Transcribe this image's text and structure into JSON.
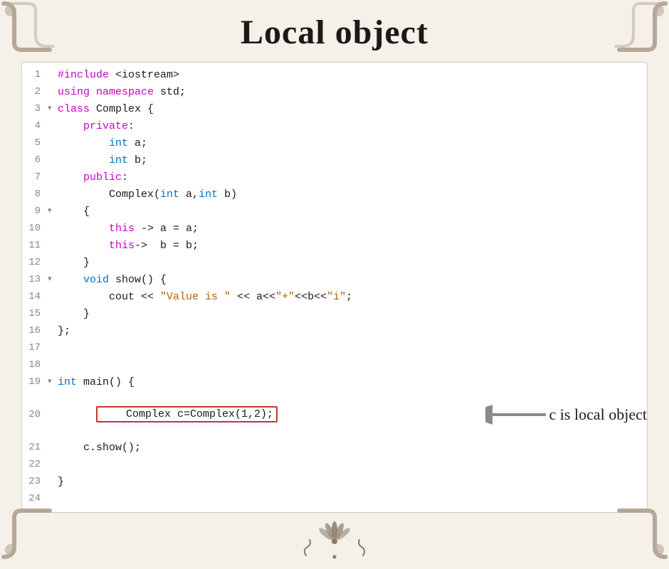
{
  "title": "Local object",
  "lines": [
    {
      "num": "1",
      "arrow": "",
      "code": "<span class='kw-purple'>#include</span> <span class='kw-dark'>&lt;iostream&gt;</span>"
    },
    {
      "num": "2",
      "arrow": "",
      "code": "<span class='kw-purple'>using namespace</span> <span class='kw-dark'>std;</span>"
    },
    {
      "num": "3",
      "arrow": "▾",
      "code": "<span class='kw-purple'>class</span> <span class='kw-dark'>Complex {</span>"
    },
    {
      "num": "4",
      "arrow": "",
      "code": "    <span class='kw-purple'>private</span><span class='kw-dark'>:</span>"
    },
    {
      "num": "5",
      "arrow": "",
      "code": "        <span class='kw-blue'>int</span> <span class='kw-dark'>a;</span>"
    },
    {
      "num": "6",
      "arrow": "",
      "code": "        <span class='kw-blue'>int</span> <span class='kw-dark'>b;</span>"
    },
    {
      "num": "7",
      "arrow": "",
      "code": "    <span class='kw-purple'>public</span><span class='kw-dark'>:</span>"
    },
    {
      "num": "8",
      "arrow": "",
      "code": "        <span class='kw-dark'>Complex(</span><span class='kw-blue'>int</span><span class='kw-dark'> a,</span><span class='kw-blue'>int</span><span class='kw-dark'> b)</span>"
    },
    {
      "num": "9",
      "arrow": "▾",
      "code": "    <span class='kw-dark'>{</span>"
    },
    {
      "num": "10",
      "arrow": "",
      "code": "        <span class='kw-purple'>this</span><span class='kw-dark'> -&gt; a = a;</span>"
    },
    {
      "num": "11",
      "arrow": "",
      "code": "        <span class='kw-purple'>this</span><span class='kw-dark'>-&gt;  b = b;</span>"
    },
    {
      "num": "12",
      "arrow": "",
      "code": "    <span class='kw-dark'>}</span>"
    },
    {
      "num": "13",
      "arrow": "▾",
      "code": "    <span class='kw-blue'>void</span><span class='kw-dark'> show() {</span>"
    },
    {
      "num": "14",
      "arrow": "",
      "code": "        <span class='kw-dark'>cout &lt;&lt; </span><span class='str-orange'>\"Value is \"</span><span class='kw-dark'> &lt;&lt; a&lt;&lt;</span><span class='str-orange'>\"+\"</span><span class='kw-dark'>&lt;&lt;b&lt;&lt;</span><span class='str-orange'>\"i\"</span><span class='kw-dark'>;</span>"
    },
    {
      "num": "15",
      "arrow": "",
      "code": "    <span class='kw-dark'>}</span>"
    },
    {
      "num": "16",
      "arrow": "",
      "code": "<span class='kw-dark'>};</span>"
    },
    {
      "num": "17",
      "arrow": "",
      "code": ""
    },
    {
      "num": "18",
      "arrow": "",
      "code": ""
    },
    {
      "num": "19",
      "arrow": "▾",
      "code": "<span class='kw-blue'>int</span><span class='kw-dark'> main() {</span>"
    },
    {
      "num": "20",
      "arrow": "",
      "code": "BOXED"
    },
    {
      "num": "21",
      "arrow": "",
      "code": "    <span class='kw-dark'>c.show();</span>"
    },
    {
      "num": "22",
      "arrow": "",
      "code": ""
    },
    {
      "num": "23",
      "arrow": "",
      "code": "<span class='kw-dark'>}</span>"
    },
    {
      "num": "24",
      "arrow": "",
      "code": ""
    }
  ],
  "annotation": "c is local object",
  "boxed_code": "    Complex c=Complex(1,2);"
}
